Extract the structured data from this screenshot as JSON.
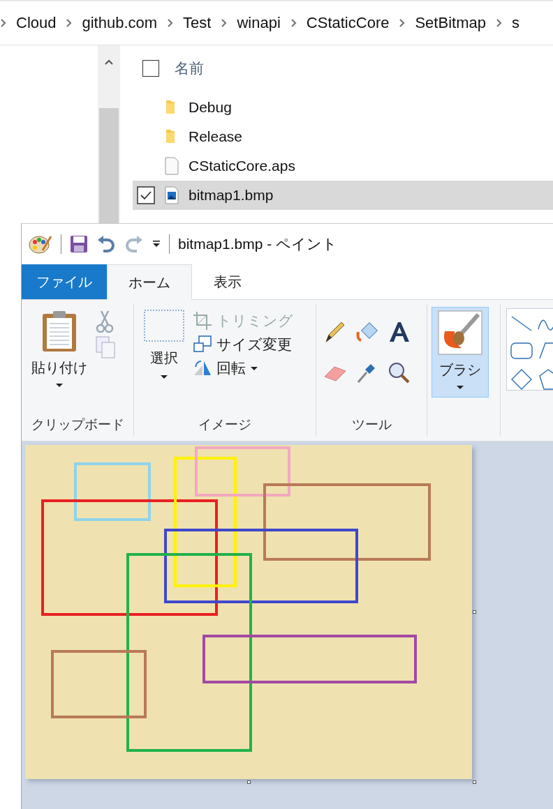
{
  "breadcrumb": [
    {
      "label": "Cloud"
    },
    {
      "label": "github.com"
    },
    {
      "label": "Test"
    },
    {
      "label": "winapi"
    },
    {
      "label": "CStaticCore"
    },
    {
      "label": "SetBitmap"
    },
    {
      "label": "s"
    }
  ],
  "file_list": {
    "header": {
      "label": "名前",
      "checked": false
    },
    "rows": [
      {
        "name": "Debug",
        "kind": "folder",
        "selected": false
      },
      {
        "name": "Release",
        "kind": "folder",
        "selected": false
      },
      {
        "name": "CStaticCore.aps",
        "kind": "file",
        "selected": false
      },
      {
        "name": "bitmap1.bmp",
        "kind": "image",
        "selected": true
      }
    ]
  },
  "paint": {
    "title": "bitmap1.bmp - ペイント",
    "tabs": [
      {
        "label": "ファイル",
        "kind": "file",
        "selected": false
      },
      {
        "label": "ホーム",
        "kind": "tab",
        "selected": true
      },
      {
        "label": "表示",
        "kind": "tab",
        "selected": false
      }
    ],
    "groups": [
      {
        "kind": "clipboard",
        "label": "クリップボード",
        "button": "貼り付け"
      },
      {
        "kind": "image",
        "label": "イメージ",
        "button": "選択",
        "commands": [
          {
            "label": "トリミング",
            "disabled": true,
            "dropdown": false
          },
          {
            "label": "サイズ変更",
            "disabled": false,
            "dropdown": false
          },
          {
            "label": "回転",
            "disabled": false,
            "dropdown": true
          }
        ]
      },
      {
        "kind": "tools",
        "label": "ツール"
      },
      {
        "kind": "brushes",
        "button": "ブラシ",
        "selected": true
      },
      {
        "kind": "shapes"
      }
    ]
  }
}
